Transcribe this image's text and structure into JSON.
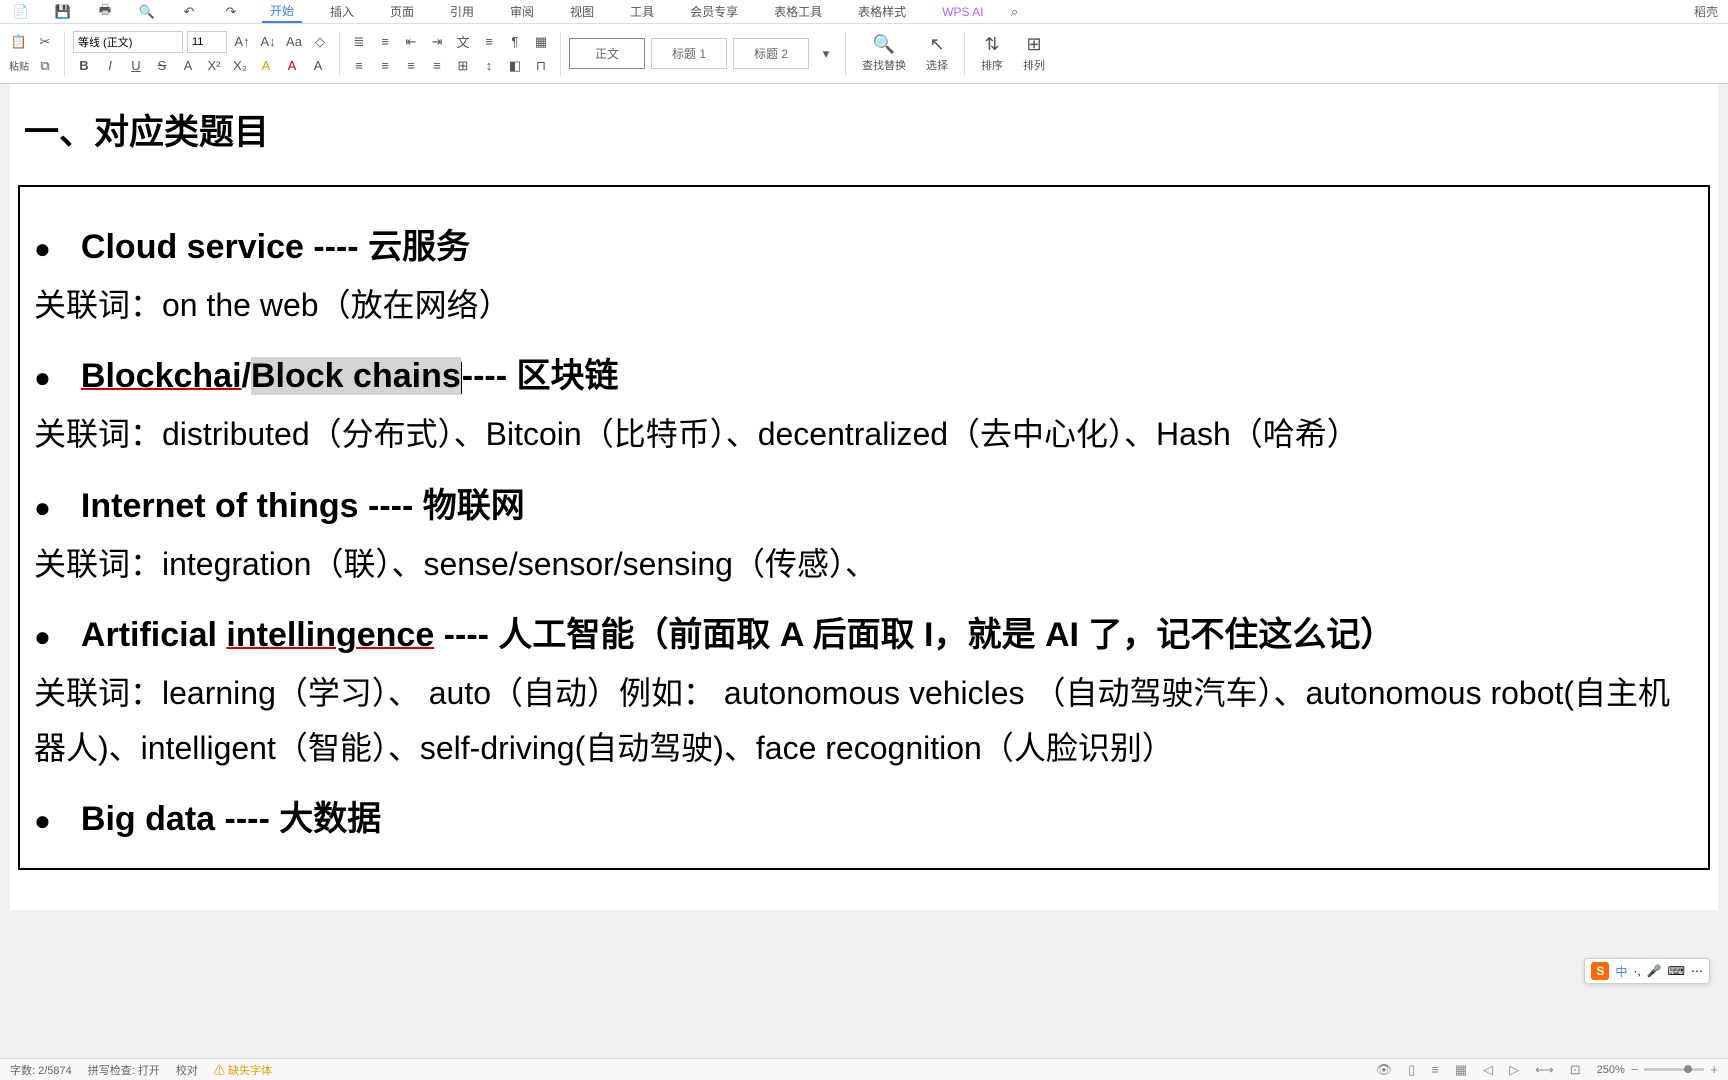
{
  "menu": {
    "tabs": [
      "开始",
      "插入",
      "页面",
      "引用",
      "审阅",
      "视图",
      "工具",
      "会员专享",
      "表格工具",
      "表格样式"
    ],
    "active_index": 0,
    "ai_label": "WPS AI",
    "right_label": "稻壳"
  },
  "ribbon": {
    "font_name": "等线 (正文)",
    "font_size": "11",
    "styles": {
      "normal": "正文",
      "heading1": "标题 1",
      "heading2": "标题 2"
    },
    "find": "查找替换",
    "select": "选择",
    "sort": "排序",
    "arrange": "排列"
  },
  "doc": {
    "heading": "一、对应类题目",
    "items": [
      {
        "title_bold": "Cloud service ----  云服务",
        "assoc": "关联词：on the web（放在网络）"
      },
      {
        "title_underline1": "Blockchai",
        "title_slash": "/",
        "title_highlight": "Block chains",
        "title_rest": "----  区块链",
        "assoc": "关联词：distributed（分布式）、Bitcoin（比特币）、decentralized（去中心化）、Hash（哈希）"
      },
      {
        "title_bold": "Internet of things ----  物联网",
        "assoc": "关联词：integration（联）、sense/sensor/sensing（传感）、"
      },
      {
        "title_pre": "Artificial ",
        "title_underline": "intellingence",
        "title_rest": " ----  人工智能（前面取 A 后面取 I，就是 AI 了，记不住这么记）",
        "assoc": "关联词：learning（学习）、 auto（自动）例如： autonomous vehicles （自动驾驶汽车）、autonomous robot(自主机器人)、intelligent（智能）、self-driving(自动驾驶)、face recognition（人脸识别）"
      },
      {
        "title_bold": "Big data ----  大数据",
        "assoc": ""
      }
    ]
  },
  "status": {
    "word_count": "字数: 2/5874",
    "spellcheck": "拼写检查: 打开",
    "proof": "校对",
    "missing_font": "缺失字体",
    "zoom": "250%"
  },
  "ime": {
    "lang": "中"
  }
}
